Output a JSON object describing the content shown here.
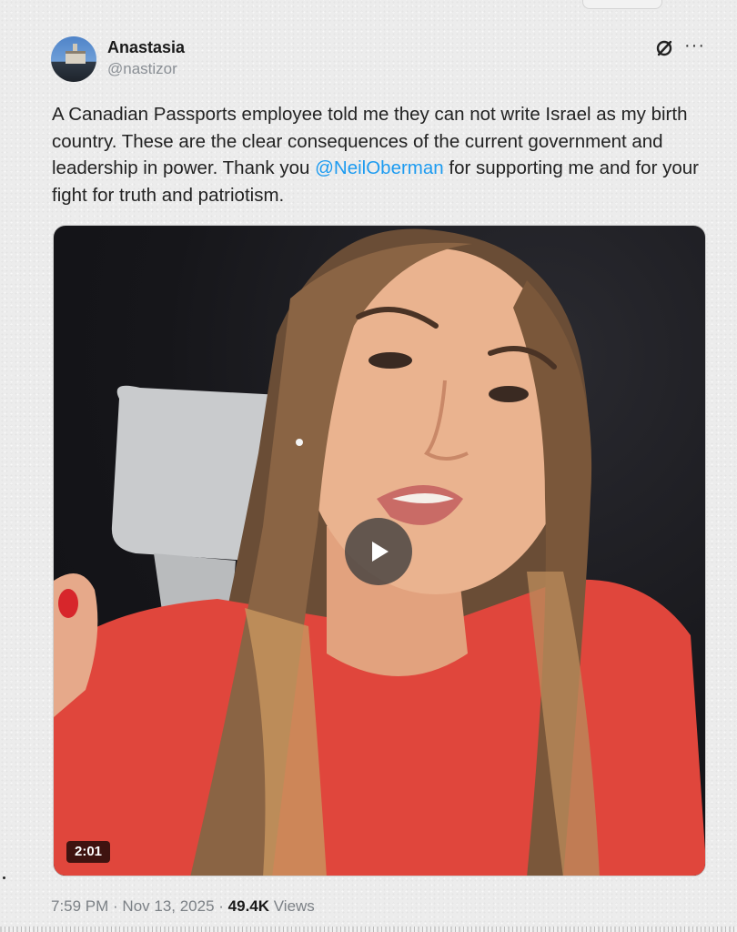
{
  "author": {
    "name": "Anastasia",
    "handle": "@nastizor",
    "avatar_icon": "profile-photo"
  },
  "header_icons": {
    "grok": "grok-icon",
    "more": "more-options-icon",
    "more_glyph": "···"
  },
  "tweet": {
    "text_before": "A Canadian Passports employee told me they can not write Israel as my birth country. These are the clear consequences of the current government and leadership in power. Thank you ",
    "mention": "@NeilOberman",
    "text_after": " for supporting me and for your fight for truth and patriotism."
  },
  "media": {
    "type": "video",
    "duration": "2:01",
    "play_icon": "play-icon"
  },
  "meta": {
    "time": "7:59 PM",
    "separator1": " · ",
    "date": "Nov 13, 2025",
    "separator2": " · ",
    "views_count": "49.4K",
    "views_label": " Views"
  },
  "colors": {
    "mention": "#1d9bf0",
    "text": "#222222",
    "muted": "#7c8186"
  }
}
